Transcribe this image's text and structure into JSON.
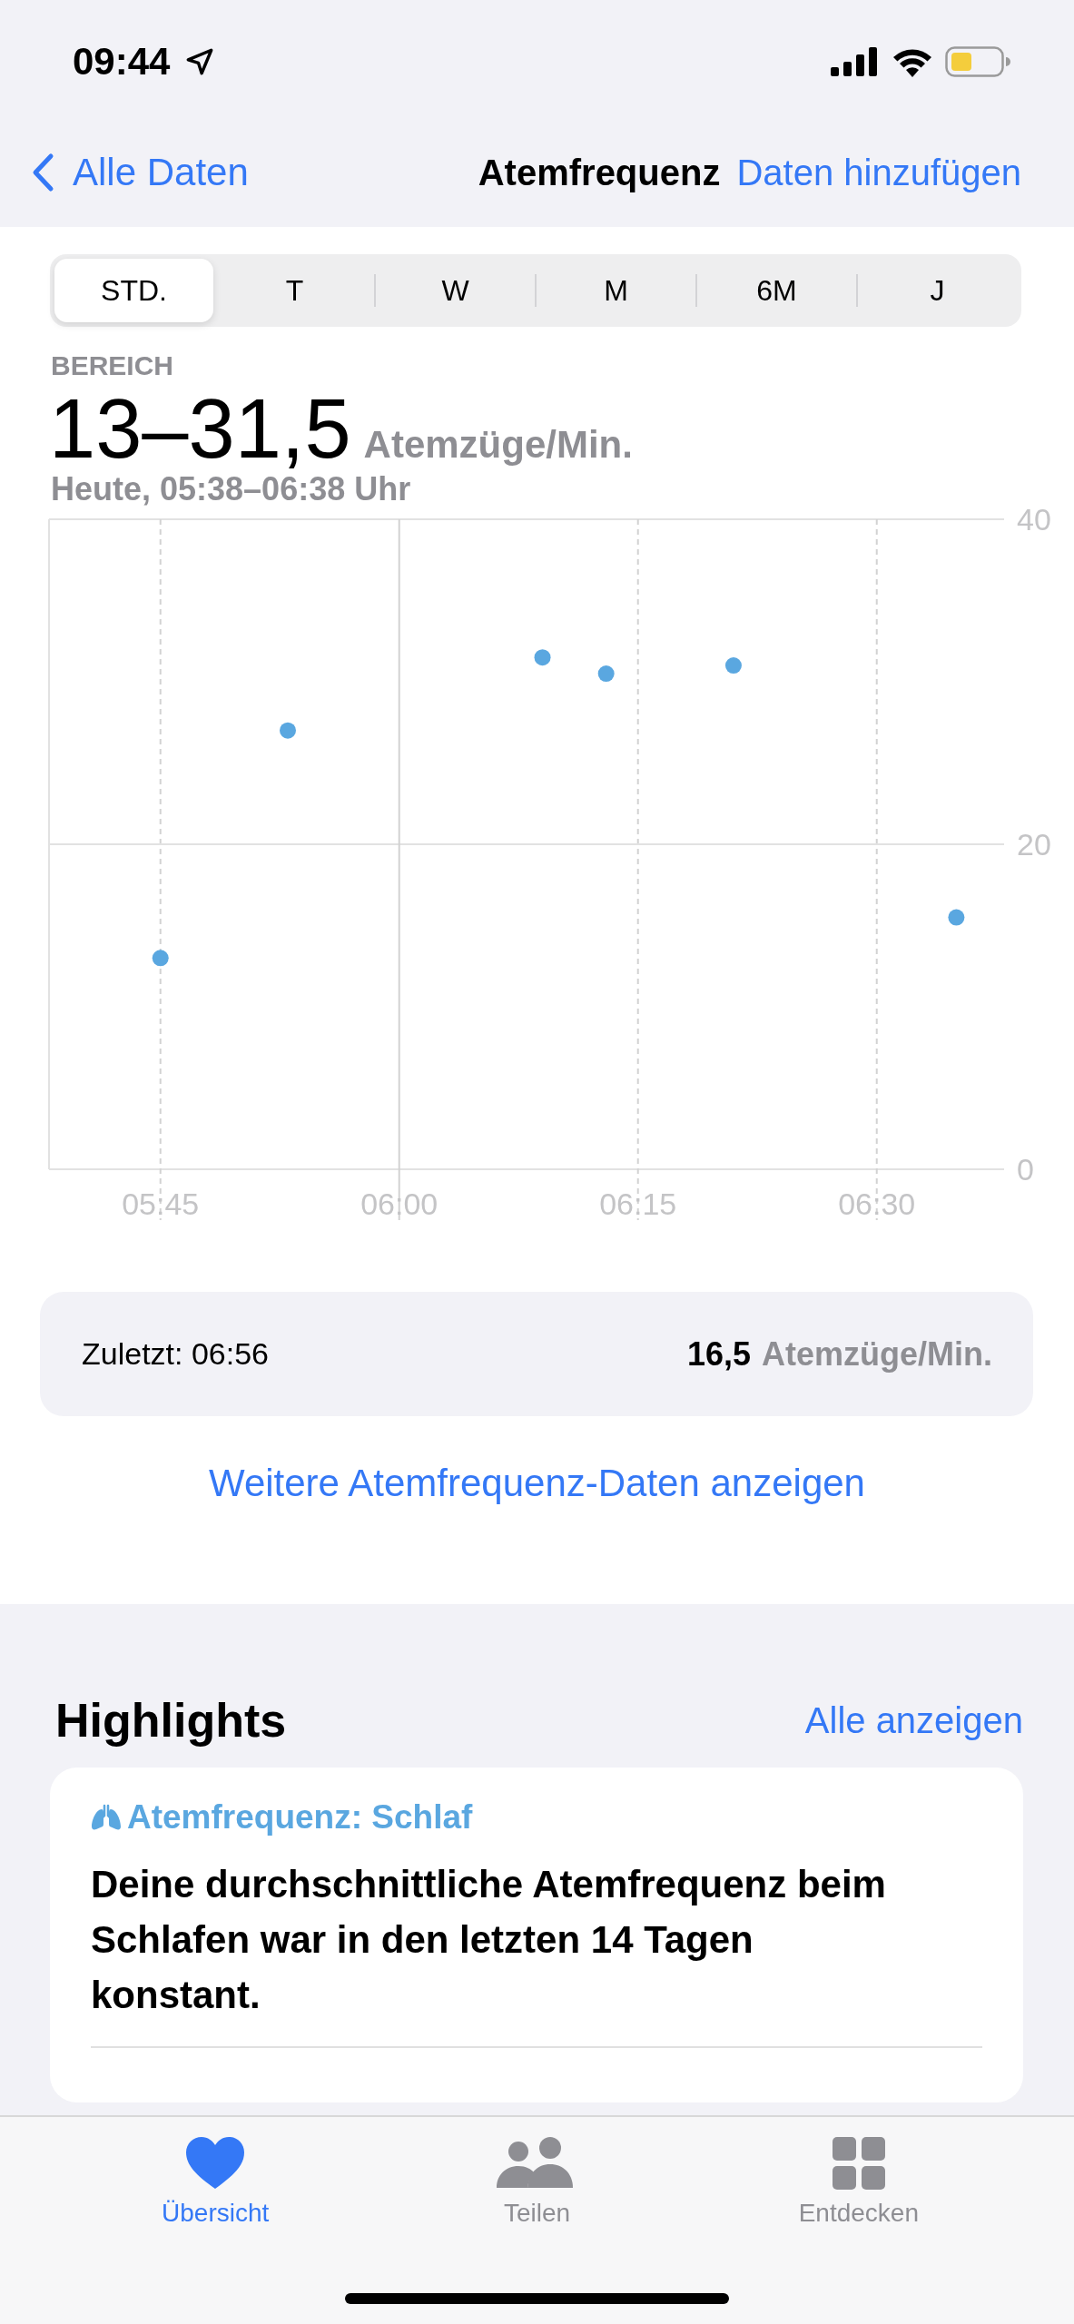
{
  "status_bar": {
    "time": "09:44"
  },
  "nav": {
    "back": "Alle Daten",
    "title": "Atemfrequenz",
    "action": "Daten hinzufügen"
  },
  "segments": [
    {
      "label": "STD.",
      "selected": true
    },
    {
      "label": "T",
      "selected": false
    },
    {
      "label": "W",
      "selected": false
    },
    {
      "label": "M",
      "selected": false
    },
    {
      "label": "6M",
      "selected": false
    },
    {
      "label": "J",
      "selected": false
    }
  ],
  "range": {
    "label": "BEREICH",
    "value": "13–31,5",
    "unit": "Atemzüge/Min.",
    "period": "Heute, 05:38–06:38 Uhr"
  },
  "chart_data": {
    "type": "scatter",
    "x": [
      345,
      353,
      369,
      373,
      381,
      395
    ],
    "series": [
      {
        "color": "#5aa7e0",
        "values": [
          13,
          27,
          31.5,
          30.5,
          31,
          15.5
        ]
      }
    ],
    "xlim": [
      338,
      398
    ],
    "ylim": [
      0,
      40
    ],
    "xticks": [
      {
        "value": 345,
        "label": "05:45"
      },
      {
        "value": 360,
        "label": "06:00"
      },
      {
        "value": 375,
        "label": "06:15"
      },
      {
        "value": 390,
        "label": "06:30"
      }
    ],
    "yticks": [
      0,
      20,
      40
    ],
    "grid": true,
    "ref_lines": [
      {
        "axis": "y",
        "value": 20
      },
      {
        "axis": "x",
        "value": 360
      }
    ]
  },
  "latest": {
    "label": "Zuletzt: 06:56",
    "value": "16,5",
    "unit": "Atemzüge/Min."
  },
  "more_link": "Weitere Atemfrequenz-Daten anzeigen",
  "highlights": {
    "title": "Highlights",
    "action": "Alle anzeigen",
    "cards": [
      {
        "title": "Atemfrequenz: Schlaf",
        "text": "Deine durchschnittliche Atemfrequenz beim Schlafen war in den letzten 14 Tagen konstant."
      }
    ]
  },
  "tab_bar": [
    {
      "label": "Übersicht",
      "selected": true
    },
    {
      "label": "Teilen",
      "selected": false
    },
    {
      "label": "Entdecken",
      "selected": false
    }
  ]
}
